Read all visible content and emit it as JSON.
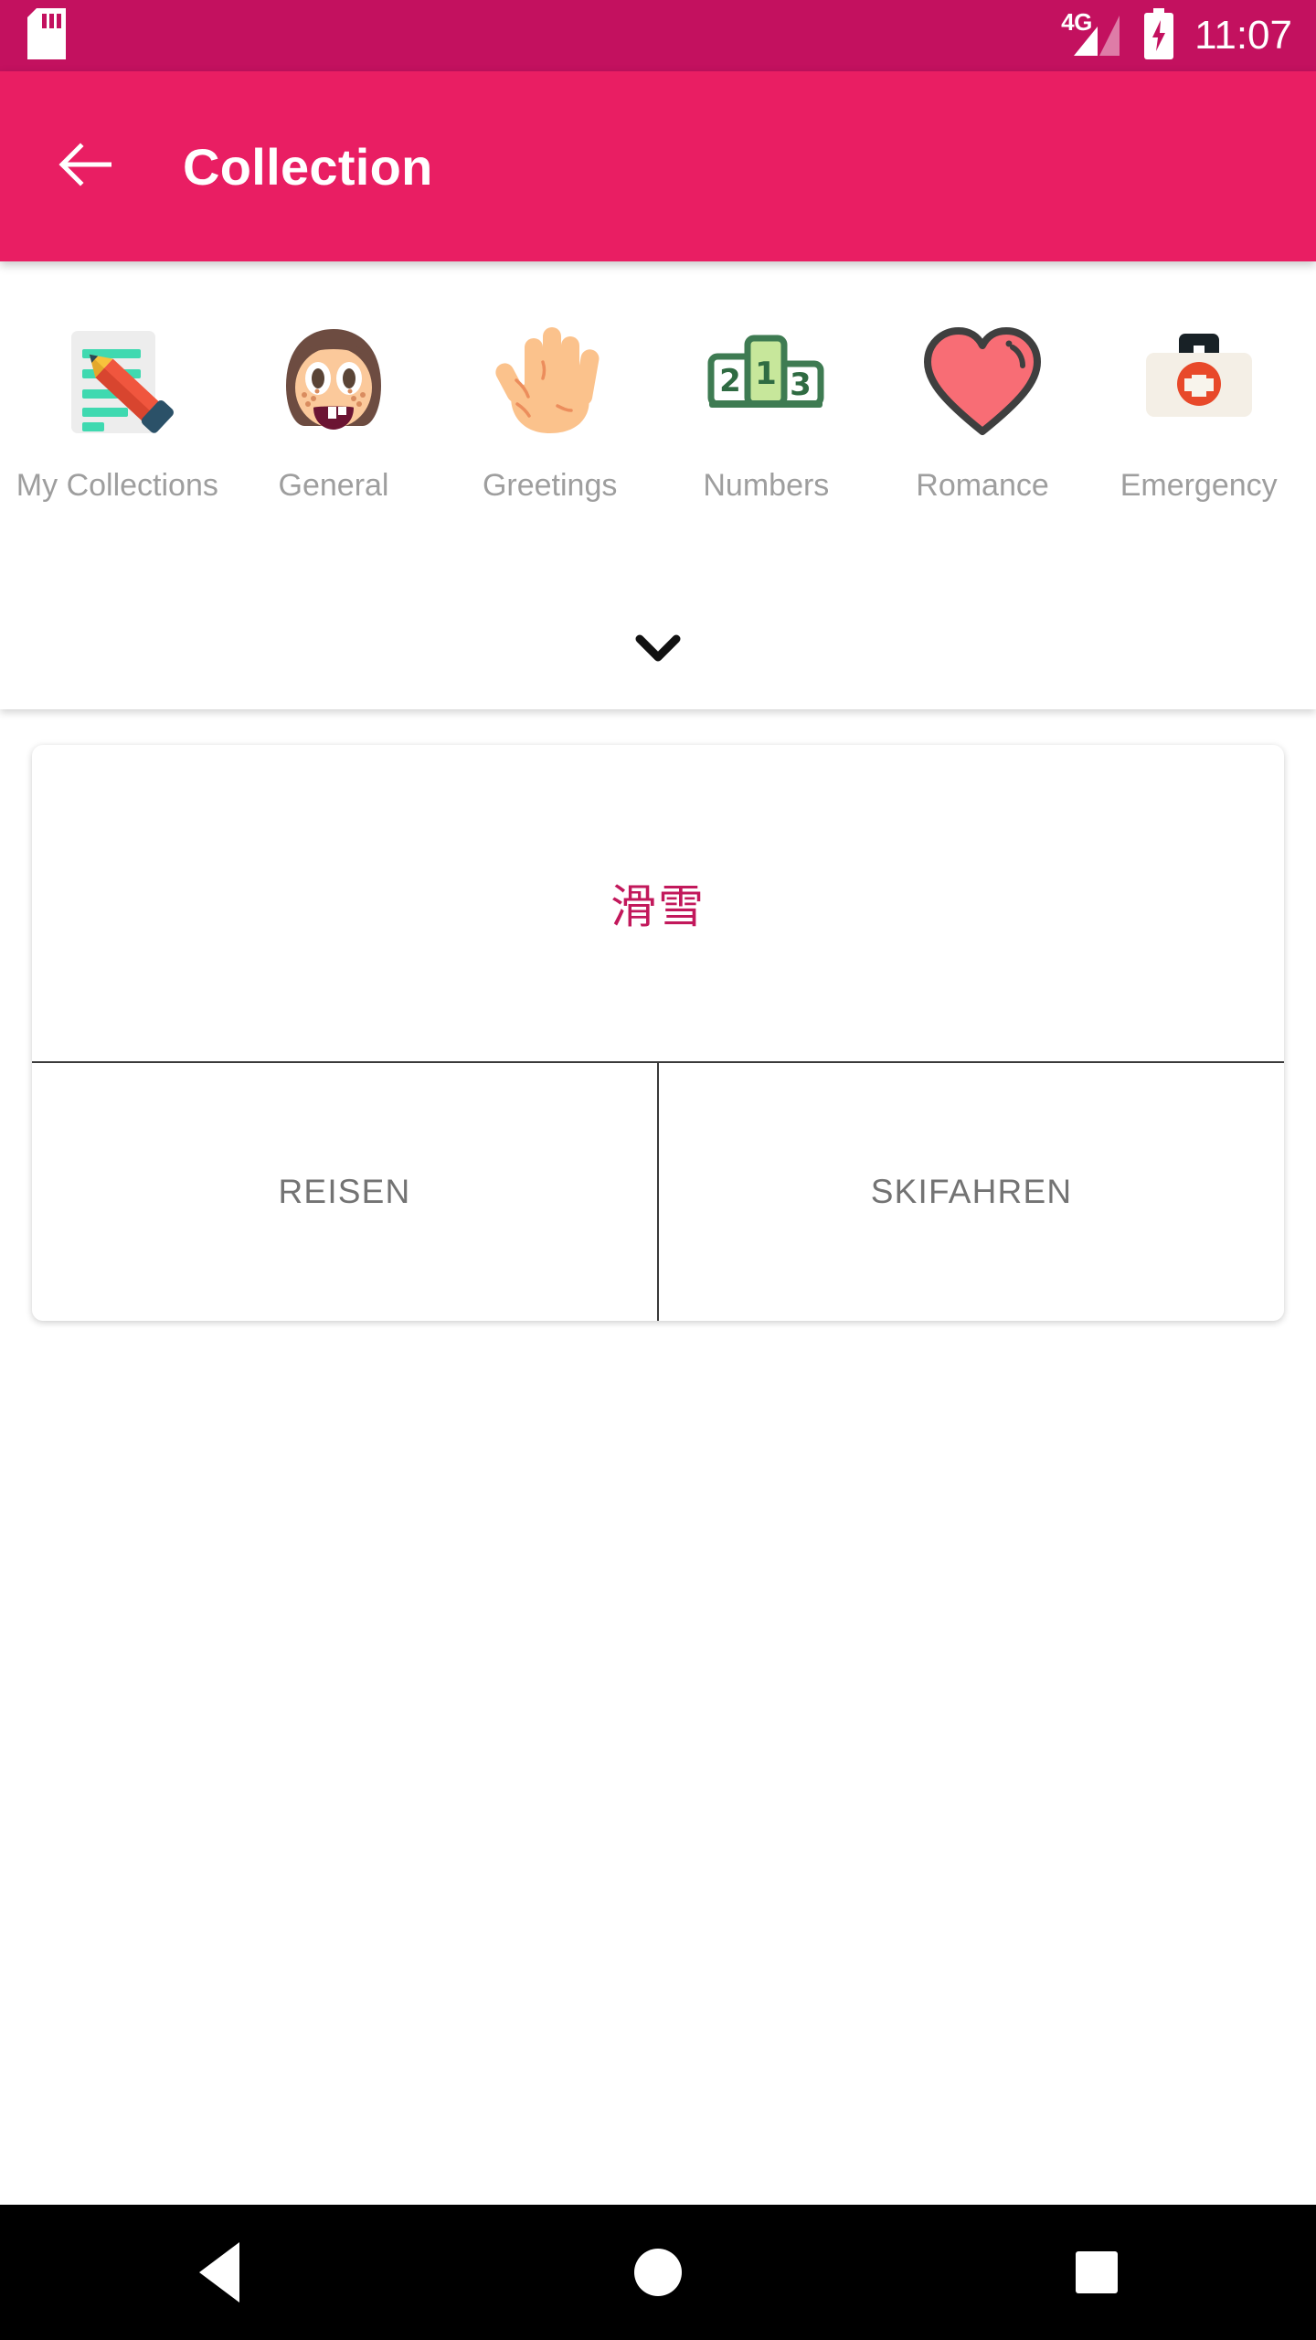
{
  "status_bar": {
    "sd_card_icon": "sd-card-icon",
    "network_label": "4G",
    "signal_icon": "signal-bars-icon",
    "battery_icon": "battery-charging-icon",
    "time": "11:07",
    "background_color": "#C3115F"
  },
  "app_bar": {
    "back_icon": "back-arrow-icon",
    "title": "Collection",
    "background_color": "#E91E63",
    "text_color": "#FFFFFF"
  },
  "categories": {
    "label_color": "#9E9E9E",
    "expand_icon": "chevron-down-icon",
    "items": [
      {
        "label": "My Collections",
        "icon": "memo-pencil-emoji"
      },
      {
        "label": "General",
        "icon": "child-face-emoji"
      },
      {
        "label": "Greetings",
        "icon": "raised-hand-emoji"
      },
      {
        "label": "Numbers",
        "icon": "podium-123-emoji"
      },
      {
        "label": "Romance",
        "icon": "heart-emoji"
      },
      {
        "label": "Emergency",
        "icon": "first-aid-kit-emoji"
      }
    ]
  },
  "card": {
    "term": "滑雪",
    "term_color": "#C2185B",
    "actions": [
      {
        "label": "REISEN"
      },
      {
        "label": "SKIFAHREN"
      }
    ],
    "action_text_color": "#737373"
  },
  "nav_bar": {
    "back_icon": "nav-back-triangle-icon",
    "home_icon": "nav-home-circle-icon",
    "recents_icon": "nav-recents-square-icon",
    "background_color": "#000000"
  }
}
